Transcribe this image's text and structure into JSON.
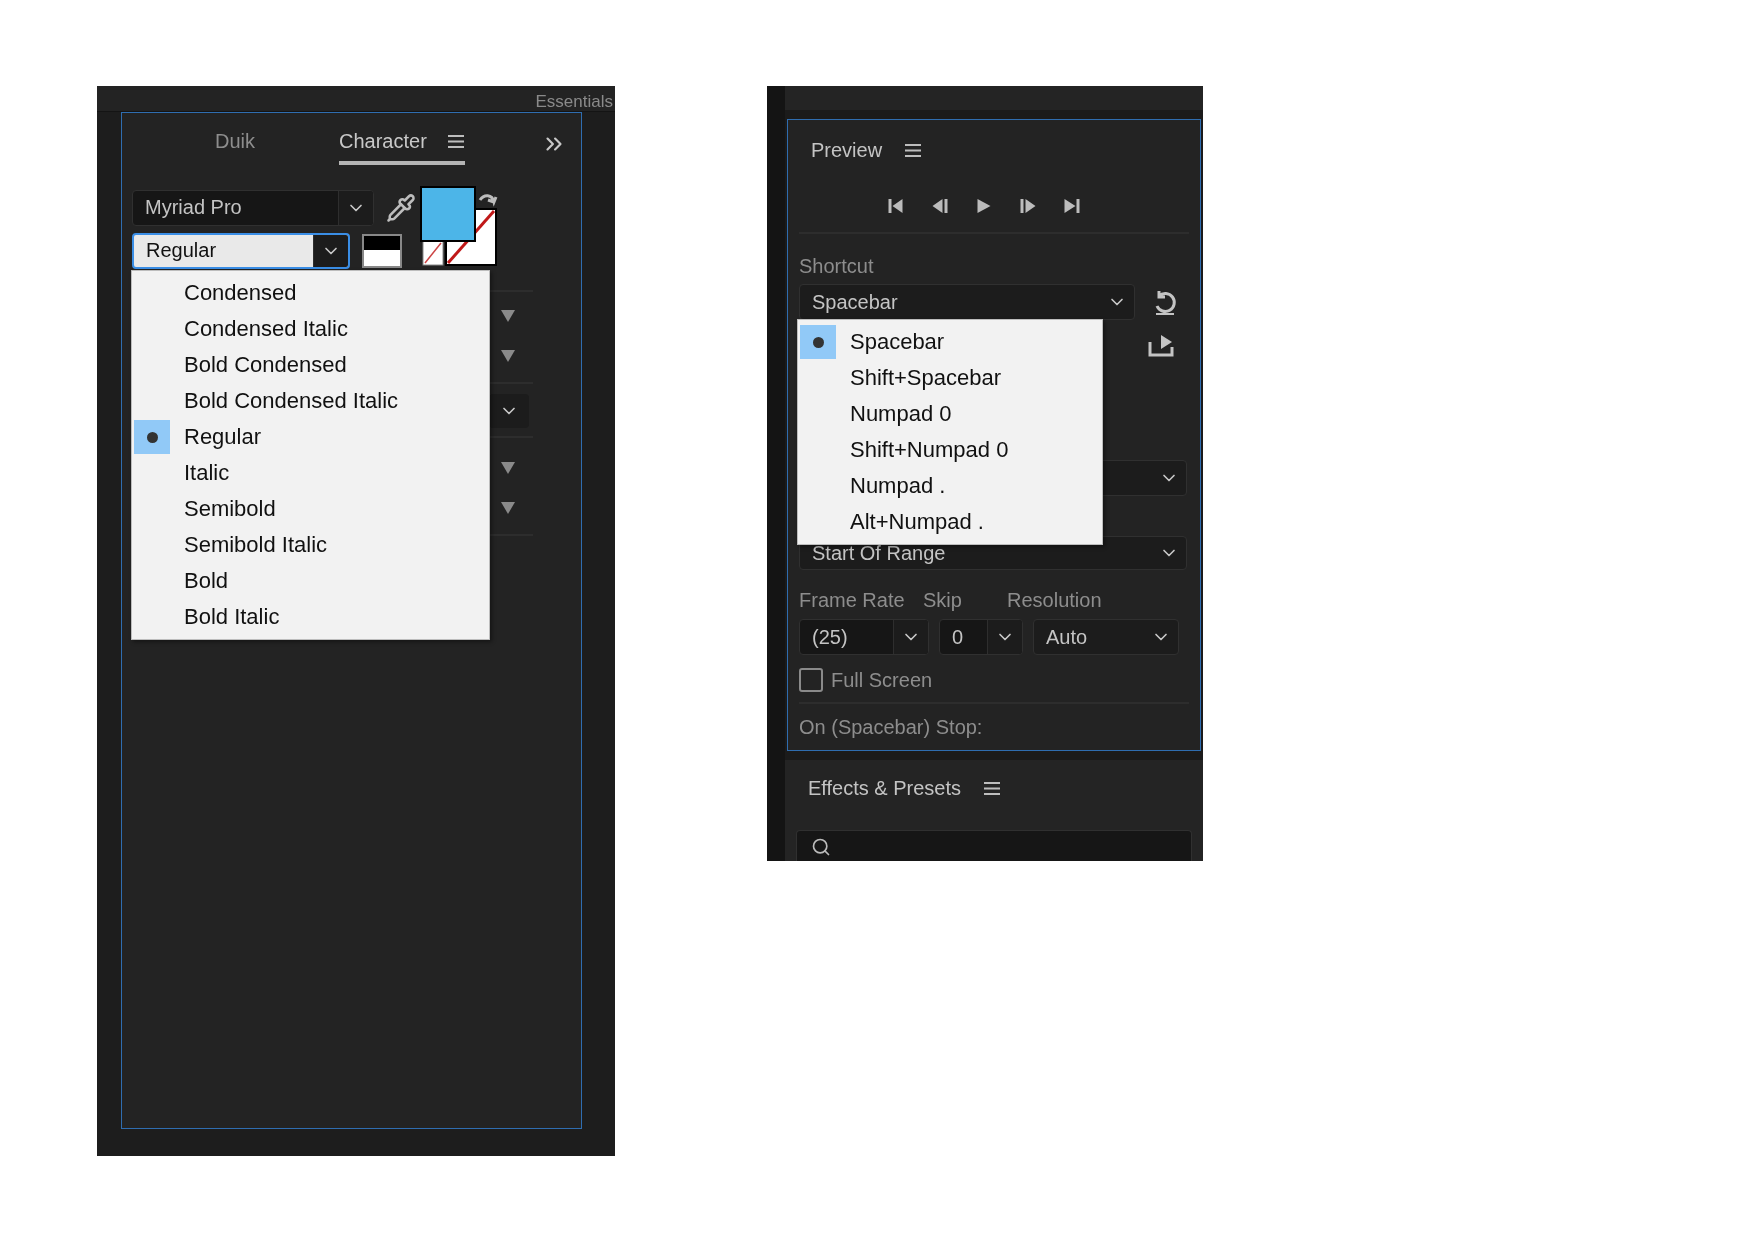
{
  "character_panel": {
    "top_tab": "Essentials",
    "tabs": [
      {
        "label": "Duik",
        "selected": false
      },
      {
        "label": "Character",
        "selected": true
      }
    ],
    "font_family": "Myriad Pro",
    "font_style": "Regular",
    "style_menu": [
      {
        "label": "Condensed",
        "selected": false
      },
      {
        "label": "Condensed Italic",
        "selected": false
      },
      {
        "label": "Bold Condensed",
        "selected": false
      },
      {
        "label": "Bold Condensed Italic",
        "selected": false
      },
      {
        "label": "Regular",
        "selected": true
      },
      {
        "label": "Italic",
        "selected": false
      },
      {
        "label": "Semibold",
        "selected": false
      },
      {
        "label": "Semibold Italic",
        "selected": false
      },
      {
        "label": "Bold",
        "selected": false
      },
      {
        "label": "Bold Italic",
        "selected": false
      }
    ]
  },
  "preview_panel": {
    "title": "Preview",
    "shortcut_label": "Shortcut",
    "shortcut": "Spacebar",
    "shortcut_menu": [
      {
        "label": "Spacebar",
        "selected": true
      },
      {
        "label": "Shift+Spacebar",
        "selected": false
      },
      {
        "label": "Numpad 0",
        "selected": false
      },
      {
        "label": "Shift+Numpad 0",
        "selected": false
      },
      {
        "label": "Numpad .",
        "selected": false
      },
      {
        "label": "Alt+Numpad .",
        "selected": false
      }
    ],
    "range": "Start Of Range",
    "frame_rate_label": "Frame Rate",
    "skip_label": "Skip",
    "resolution_label": "Resolution",
    "frame_rate": "(25)",
    "skip": "0",
    "resolution": "Auto",
    "full_screen": {
      "label": "Full Screen",
      "checked": false
    },
    "stop_label": "On (Spacebar) Stop:"
  },
  "effects_panel": {
    "title": "Effects & Presets"
  }
}
